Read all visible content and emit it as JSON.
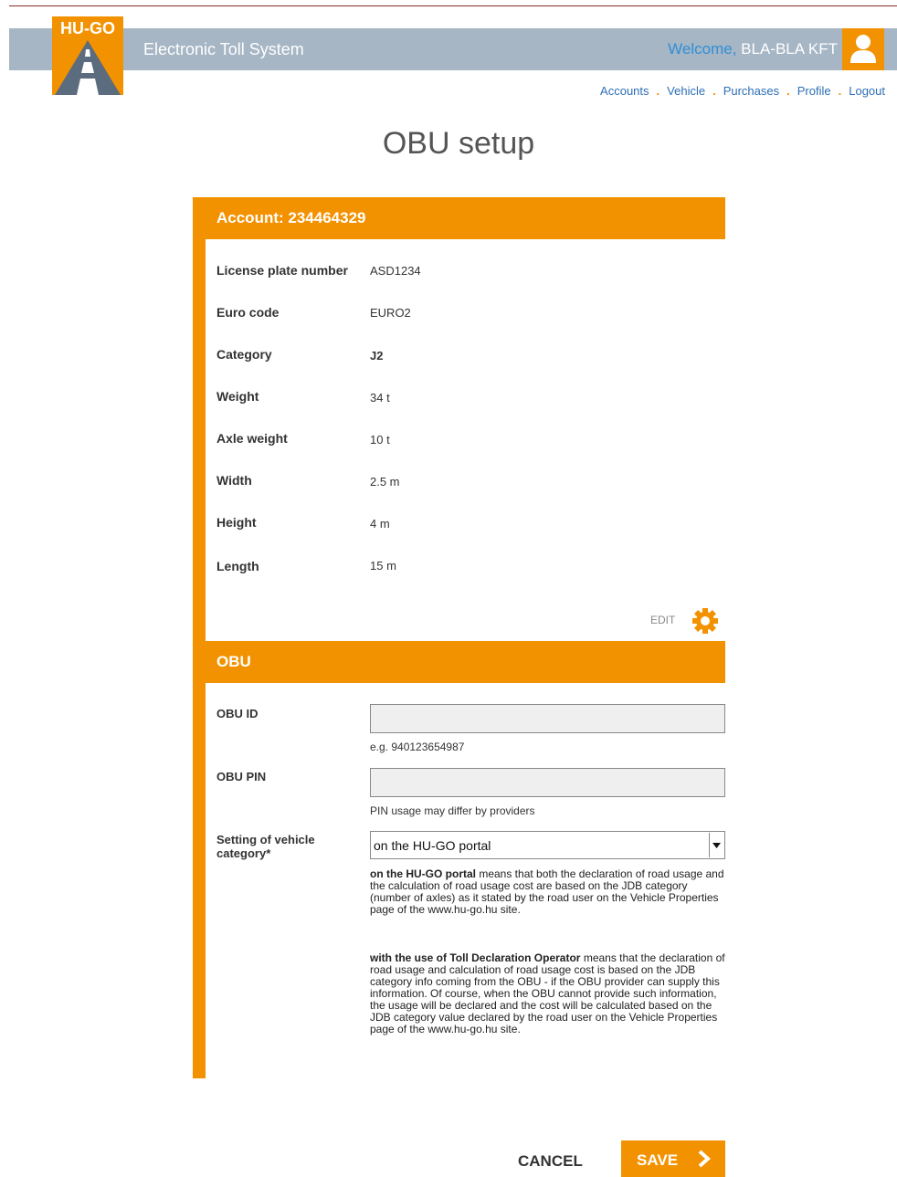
{
  "brand": {
    "logo_text": "HU-GO",
    "app_title": "Electronic Toll System"
  },
  "user": {
    "welcome_prefix": "Welcome,",
    "company": "BLA-BLA KFT"
  },
  "nav": {
    "items": [
      {
        "label": "Accounts"
      },
      {
        "label": "Vehicle"
      },
      {
        "label": "Purchases"
      },
      {
        "label": "Profile"
      },
      {
        "label": "Logout"
      }
    ]
  },
  "page": {
    "title": "OBU setup"
  },
  "account": {
    "heading": "Account: 234464329",
    "rows": [
      {
        "label": "License plate number",
        "value": "ASD1234"
      },
      {
        "label": "Euro code",
        "value": "EURO2"
      },
      {
        "label": "Category",
        "value": "J2"
      },
      {
        "label": "Weight",
        "value": "34 t"
      },
      {
        "label": "Axle weight",
        "value": "10 t"
      },
      {
        "label": "Width",
        "value": "2.5 m"
      },
      {
        "label": "Height",
        "value": "4 m"
      },
      {
        "label": "Length",
        "value": "15 m"
      }
    ],
    "edit_label": "EDIT"
  },
  "obu": {
    "heading": "OBU",
    "obu_id": {
      "label": "OBU ID",
      "value": "",
      "hint": "e.g. 940123654987"
    },
    "obu_pin": {
      "label": "OBU PIN",
      "value": "",
      "hint": "PIN usage may differ by providers"
    },
    "vehicle_category": {
      "label": "Setting of vehicle category*",
      "selected": "on the HU-GO portal",
      "desc1_bold": "on the HU-GO portal",
      "desc1_text": " means that both the declaration of road usage and the calculation of road usage cost are based on the JDB category (number of axles) as it stated by the road user on the Vehicle Properties page of the www.hu-go.hu site.",
      "desc2_bold": "with the use of Toll Declaration Operator",
      "desc2_text": " means that the declaration of road usage and calculation of road usage cost is based on the JDB category info coming from the OBU - if the OBU provider can supply this information. Of course, when the OBU cannot provide such information, the usage will be declared and the cost will be calculated based on the JDB category value declared by the road user on the Vehicle Properties page of the www.hu-go.hu site."
    }
  },
  "actions": {
    "cancel_label": "CANCEL",
    "save_label": "SAVE"
  },
  "colors": {
    "accent": "#f39200",
    "header": "#a6b6c5",
    "link": "#2e6fb5"
  }
}
